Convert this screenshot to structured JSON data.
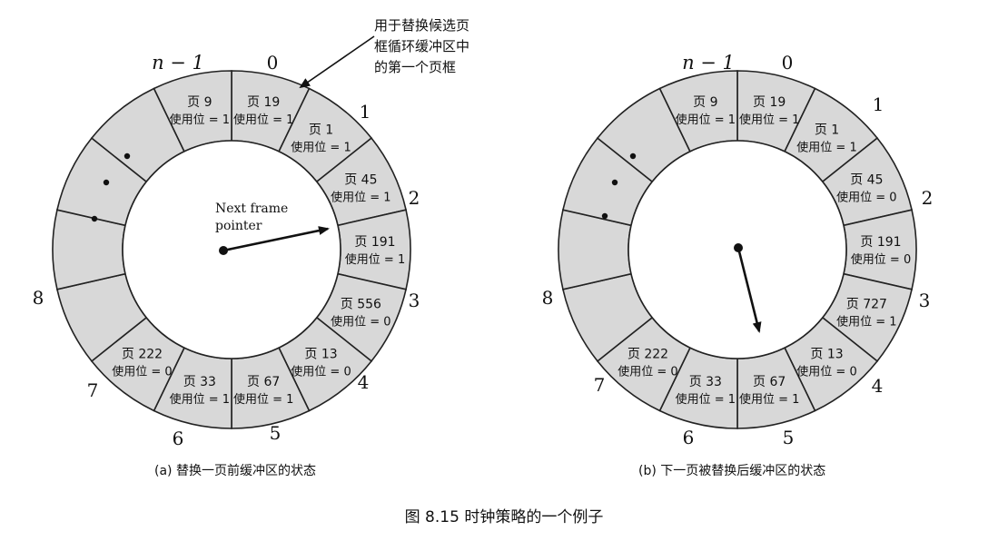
{
  "figure": {
    "caption": "图 8.15   时钟策略的一个例子",
    "annotation": [
      "用于替换候选页",
      "框循环缓冲区中",
      "的第一个页框"
    ],
    "pointer_label": [
      "Next frame",
      "pointer"
    ],
    "panel_a": {
      "caption": "(a)  替换一页前缓冲区的状态",
      "position_labels": {
        "first": "0",
        "last": "n − 1",
        "l1": "1",
        "l2": "2",
        "l3": "3",
        "l4": "4",
        "l5": "5",
        "l6": "6",
        "l7": "7",
        "l8": "8"
      },
      "frames": [
        {
          "page": "页 19",
          "use": "使用位 = 1"
        },
        {
          "page": "页 1",
          "use": "使用位 = 1"
        },
        {
          "page": "页 45",
          "use": "使用位 = 1"
        },
        {
          "page": "页 191",
          "use": "使用位 = 1"
        },
        {
          "page": "页 556",
          "use": "使用位 = 0"
        },
        {
          "page": "页 13",
          "use": "使用位 = 0"
        },
        {
          "page": "页 67",
          "use": "使用位 = 1"
        },
        {
          "page": "页 33",
          "use": "使用位 = 1"
        },
        {
          "page": "页 222",
          "use": "使用位 = 0"
        },
        {
          "page": "页 9",
          "use": "使用位 = 1"
        }
      ]
    },
    "panel_b": {
      "caption": "(b)  下一页被替换后缓冲区的状态",
      "position_labels": {
        "first": "0",
        "last": "n − 1",
        "l1": "1",
        "l2": "2",
        "l3": "3",
        "l4": "4",
        "l5": "5",
        "l6": "6",
        "l7": "7",
        "l8": "8"
      },
      "frames": [
        {
          "page": "页 19",
          "use": "使用位 = 1"
        },
        {
          "page": "页 1",
          "use": "使用位 = 1"
        },
        {
          "page": "页 45",
          "use": "使用位 = 0"
        },
        {
          "page": "页 191",
          "use": "使用位 = 0"
        },
        {
          "page": "页 727",
          "use": "使用位 = 1"
        },
        {
          "page": "页 13",
          "use": "使用位 = 0"
        },
        {
          "page": "页 67",
          "use": "使用位 = 1"
        },
        {
          "page": "页 33",
          "use": "使用位 = 1"
        },
        {
          "page": "页 222",
          "use": "使用位 = 0"
        },
        {
          "page": "页 9",
          "use": "使用位 = 1"
        }
      ]
    }
  },
  "colors": {
    "ring_fill": "#d8d8d8",
    "inner_fill": "#ffffff",
    "stroke": "#222222"
  }
}
